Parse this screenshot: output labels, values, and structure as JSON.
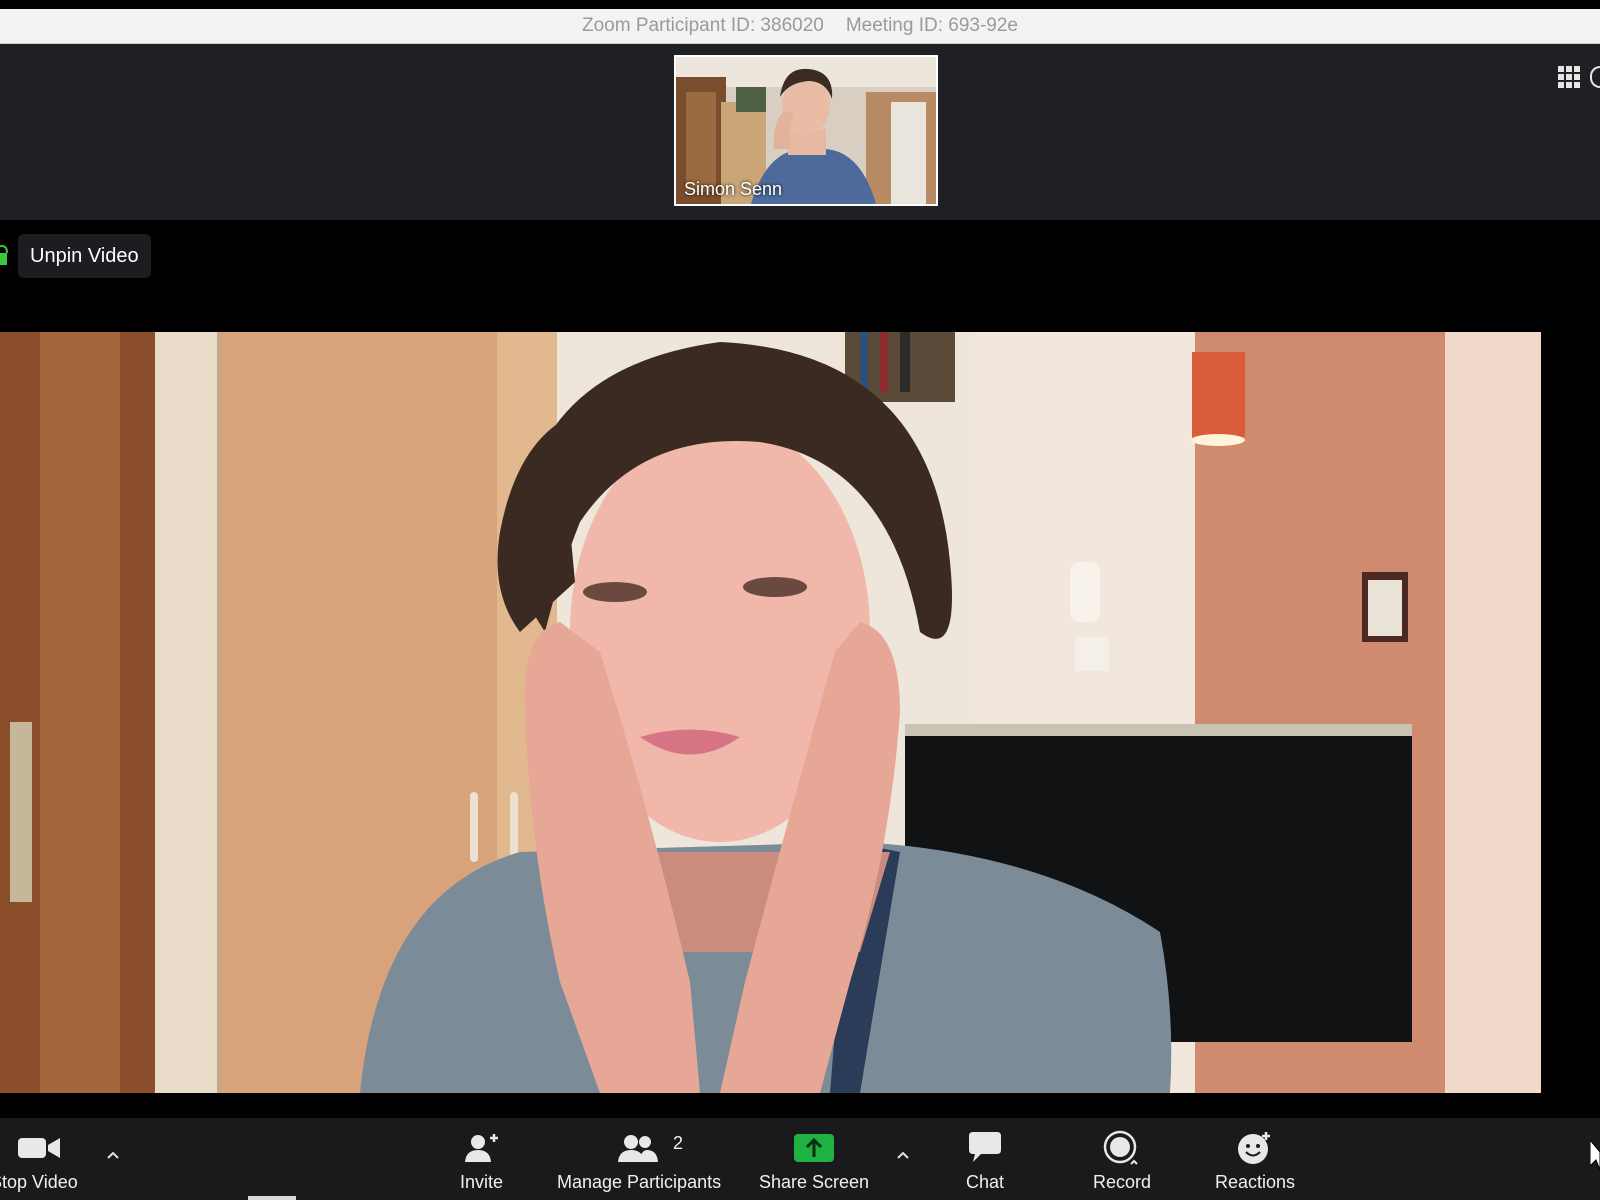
{
  "title_bar": {
    "participant_id": "Zoom Participant ID: 386020",
    "meeting_id": "Meeting ID: 693-92е"
  },
  "thumbnail": {
    "name": "Simon Senn"
  },
  "pin": {
    "unpin_label": "Unpin Video"
  },
  "toolbar": {
    "stop_video": "Stop Video",
    "invite": "Invite",
    "manage_participants": "Manage Participants",
    "participant_count": "2",
    "share_screen": "Share Screen",
    "chat": "Chat",
    "record": "Record",
    "reactions": "Reactions"
  },
  "colors": {
    "share_green": "#1fb141",
    "toolbar_bg": "#1a1a1c",
    "strip_bg": "#1f2023"
  },
  "icons": [
    "video-camera-icon",
    "add-person-icon",
    "participants-icon",
    "share-arrow-icon",
    "chat-bubble-icon",
    "record-icon",
    "reaction-smiley-icon",
    "grid-view-icon",
    "lock-icon",
    "chevron-up-icon",
    "mouse-cursor-icon"
  ]
}
